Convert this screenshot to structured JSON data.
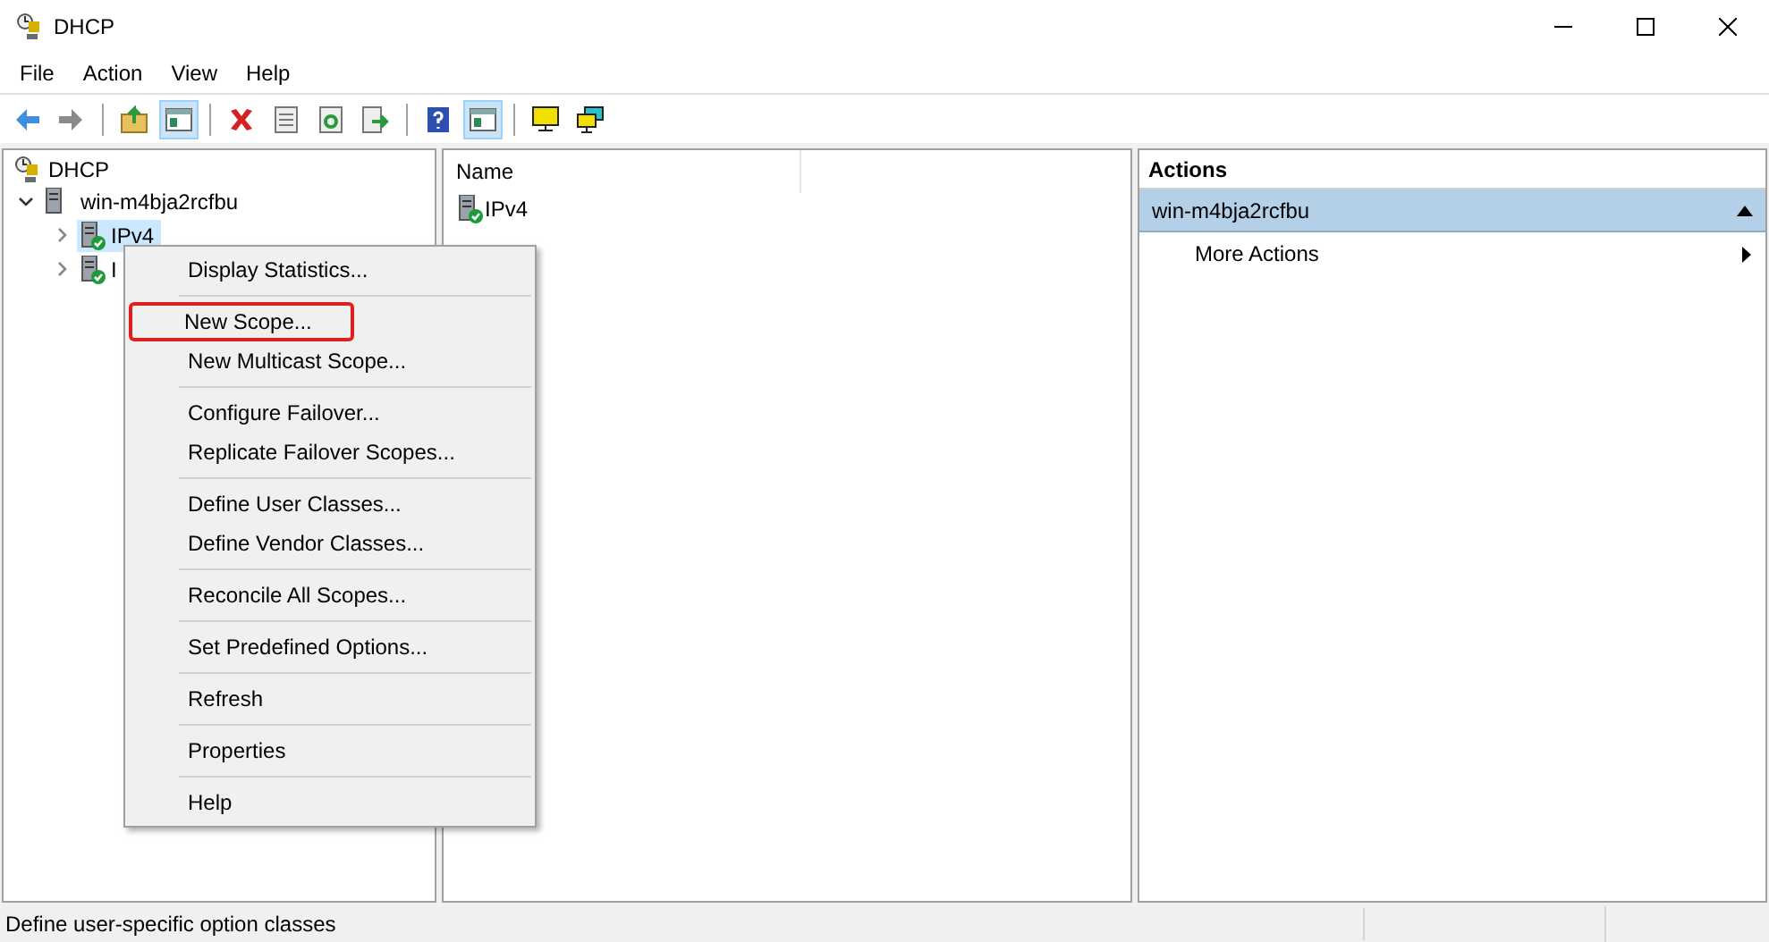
{
  "window": {
    "title": "DHCP"
  },
  "menu_bar": [
    "File",
    "Action",
    "View",
    "Help"
  ],
  "toolbar": [
    {
      "kind": "back",
      "pressed": false
    },
    {
      "kind": "forward",
      "pressed": false
    },
    {
      "kind": "sep"
    },
    {
      "kind": "up",
      "pressed": false
    },
    {
      "kind": "pane",
      "pressed": true
    },
    {
      "kind": "sep"
    },
    {
      "kind": "delete",
      "pressed": false
    },
    {
      "kind": "props",
      "pressed": false
    },
    {
      "kind": "refresh",
      "pressed": false
    },
    {
      "kind": "export",
      "pressed": false
    },
    {
      "kind": "sep"
    },
    {
      "kind": "help",
      "pressed": false
    },
    {
      "kind": "pane",
      "pressed": true
    },
    {
      "kind": "sep"
    },
    {
      "kind": "monitor",
      "pressed": false
    },
    {
      "kind": "monitors",
      "pressed": false
    }
  ],
  "tree": {
    "label": "DHCP",
    "children": [
      {
        "label": "win-m4bja2rcfbu",
        "expanded": true,
        "children": [
          {
            "label": "IPv4",
            "selected": true
          },
          {
            "label": "I",
            "selected": false
          }
        ]
      }
    ]
  },
  "list": {
    "columns": [
      "Name"
    ],
    "rows": [
      "IPv4"
    ]
  },
  "context_menu": {
    "groups": [
      [
        {
          "label": "Display Statistics...",
          "highlighted": false
        }
      ],
      [
        {
          "label": "New Scope...",
          "highlighted": true
        },
        {
          "label": "New Multicast Scope...",
          "highlighted": false
        }
      ],
      [
        {
          "label": "Configure Failover...",
          "highlighted": false
        },
        {
          "label": "Replicate Failover Scopes...",
          "highlighted": false
        }
      ],
      [
        {
          "label": "Define User Classes...",
          "highlighted": false
        },
        {
          "label": "Define Vendor Classes...",
          "highlighted": false
        }
      ],
      [
        {
          "label": "Reconcile All Scopes...",
          "highlighted": false
        }
      ],
      [
        {
          "label": "Set Predefined Options...",
          "highlighted": false
        }
      ],
      [
        {
          "label": "Refresh",
          "highlighted": false
        }
      ],
      [
        {
          "label": "Properties",
          "highlighted": false
        }
      ],
      [
        {
          "label": "Help",
          "highlighted": false
        }
      ]
    ]
  },
  "actions": {
    "title": "Actions",
    "section": "win-m4bja2rcfbu",
    "items": [
      "More Actions"
    ]
  },
  "status_bar": "Define user-specific option classes"
}
